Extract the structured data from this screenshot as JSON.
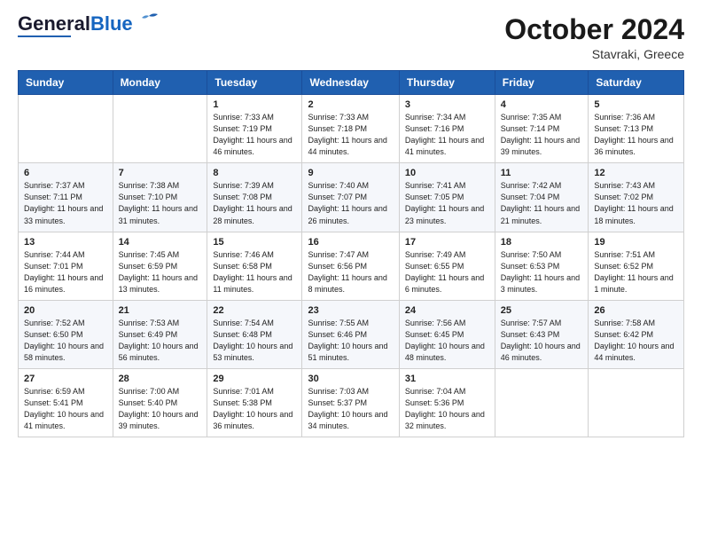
{
  "header": {
    "logo_general": "General",
    "logo_blue": "Blue",
    "month_year": "October 2024",
    "location": "Stavraki, Greece"
  },
  "weekdays": [
    "Sunday",
    "Monday",
    "Tuesday",
    "Wednesday",
    "Thursday",
    "Friday",
    "Saturday"
  ],
  "weeks": [
    [
      {
        "day": "",
        "info": ""
      },
      {
        "day": "",
        "info": ""
      },
      {
        "day": "1",
        "info": "Sunrise: 7:33 AM\nSunset: 7:19 PM\nDaylight: 11 hours and 46 minutes."
      },
      {
        "day": "2",
        "info": "Sunrise: 7:33 AM\nSunset: 7:18 PM\nDaylight: 11 hours and 44 minutes."
      },
      {
        "day": "3",
        "info": "Sunrise: 7:34 AM\nSunset: 7:16 PM\nDaylight: 11 hours and 41 minutes."
      },
      {
        "day": "4",
        "info": "Sunrise: 7:35 AM\nSunset: 7:14 PM\nDaylight: 11 hours and 39 minutes."
      },
      {
        "day": "5",
        "info": "Sunrise: 7:36 AM\nSunset: 7:13 PM\nDaylight: 11 hours and 36 minutes."
      }
    ],
    [
      {
        "day": "6",
        "info": "Sunrise: 7:37 AM\nSunset: 7:11 PM\nDaylight: 11 hours and 33 minutes."
      },
      {
        "day": "7",
        "info": "Sunrise: 7:38 AM\nSunset: 7:10 PM\nDaylight: 11 hours and 31 minutes."
      },
      {
        "day": "8",
        "info": "Sunrise: 7:39 AM\nSunset: 7:08 PM\nDaylight: 11 hours and 28 minutes."
      },
      {
        "day": "9",
        "info": "Sunrise: 7:40 AM\nSunset: 7:07 PM\nDaylight: 11 hours and 26 minutes."
      },
      {
        "day": "10",
        "info": "Sunrise: 7:41 AM\nSunset: 7:05 PM\nDaylight: 11 hours and 23 minutes."
      },
      {
        "day": "11",
        "info": "Sunrise: 7:42 AM\nSunset: 7:04 PM\nDaylight: 11 hours and 21 minutes."
      },
      {
        "day": "12",
        "info": "Sunrise: 7:43 AM\nSunset: 7:02 PM\nDaylight: 11 hours and 18 minutes."
      }
    ],
    [
      {
        "day": "13",
        "info": "Sunrise: 7:44 AM\nSunset: 7:01 PM\nDaylight: 11 hours and 16 minutes."
      },
      {
        "day": "14",
        "info": "Sunrise: 7:45 AM\nSunset: 6:59 PM\nDaylight: 11 hours and 13 minutes."
      },
      {
        "day": "15",
        "info": "Sunrise: 7:46 AM\nSunset: 6:58 PM\nDaylight: 11 hours and 11 minutes."
      },
      {
        "day": "16",
        "info": "Sunrise: 7:47 AM\nSunset: 6:56 PM\nDaylight: 11 hours and 8 minutes."
      },
      {
        "day": "17",
        "info": "Sunrise: 7:49 AM\nSunset: 6:55 PM\nDaylight: 11 hours and 6 minutes."
      },
      {
        "day": "18",
        "info": "Sunrise: 7:50 AM\nSunset: 6:53 PM\nDaylight: 11 hours and 3 minutes."
      },
      {
        "day": "19",
        "info": "Sunrise: 7:51 AM\nSunset: 6:52 PM\nDaylight: 11 hours and 1 minute."
      }
    ],
    [
      {
        "day": "20",
        "info": "Sunrise: 7:52 AM\nSunset: 6:50 PM\nDaylight: 10 hours and 58 minutes."
      },
      {
        "day": "21",
        "info": "Sunrise: 7:53 AM\nSunset: 6:49 PM\nDaylight: 10 hours and 56 minutes."
      },
      {
        "day": "22",
        "info": "Sunrise: 7:54 AM\nSunset: 6:48 PM\nDaylight: 10 hours and 53 minutes."
      },
      {
        "day": "23",
        "info": "Sunrise: 7:55 AM\nSunset: 6:46 PM\nDaylight: 10 hours and 51 minutes."
      },
      {
        "day": "24",
        "info": "Sunrise: 7:56 AM\nSunset: 6:45 PM\nDaylight: 10 hours and 48 minutes."
      },
      {
        "day": "25",
        "info": "Sunrise: 7:57 AM\nSunset: 6:43 PM\nDaylight: 10 hours and 46 minutes."
      },
      {
        "day": "26",
        "info": "Sunrise: 7:58 AM\nSunset: 6:42 PM\nDaylight: 10 hours and 44 minutes."
      }
    ],
    [
      {
        "day": "27",
        "info": "Sunrise: 6:59 AM\nSunset: 5:41 PM\nDaylight: 10 hours and 41 minutes."
      },
      {
        "day": "28",
        "info": "Sunrise: 7:00 AM\nSunset: 5:40 PM\nDaylight: 10 hours and 39 minutes."
      },
      {
        "day": "29",
        "info": "Sunrise: 7:01 AM\nSunset: 5:38 PM\nDaylight: 10 hours and 36 minutes."
      },
      {
        "day": "30",
        "info": "Sunrise: 7:03 AM\nSunset: 5:37 PM\nDaylight: 10 hours and 34 minutes."
      },
      {
        "day": "31",
        "info": "Sunrise: 7:04 AM\nSunset: 5:36 PM\nDaylight: 10 hours and 32 minutes."
      },
      {
        "day": "",
        "info": ""
      },
      {
        "day": "",
        "info": ""
      }
    ]
  ]
}
